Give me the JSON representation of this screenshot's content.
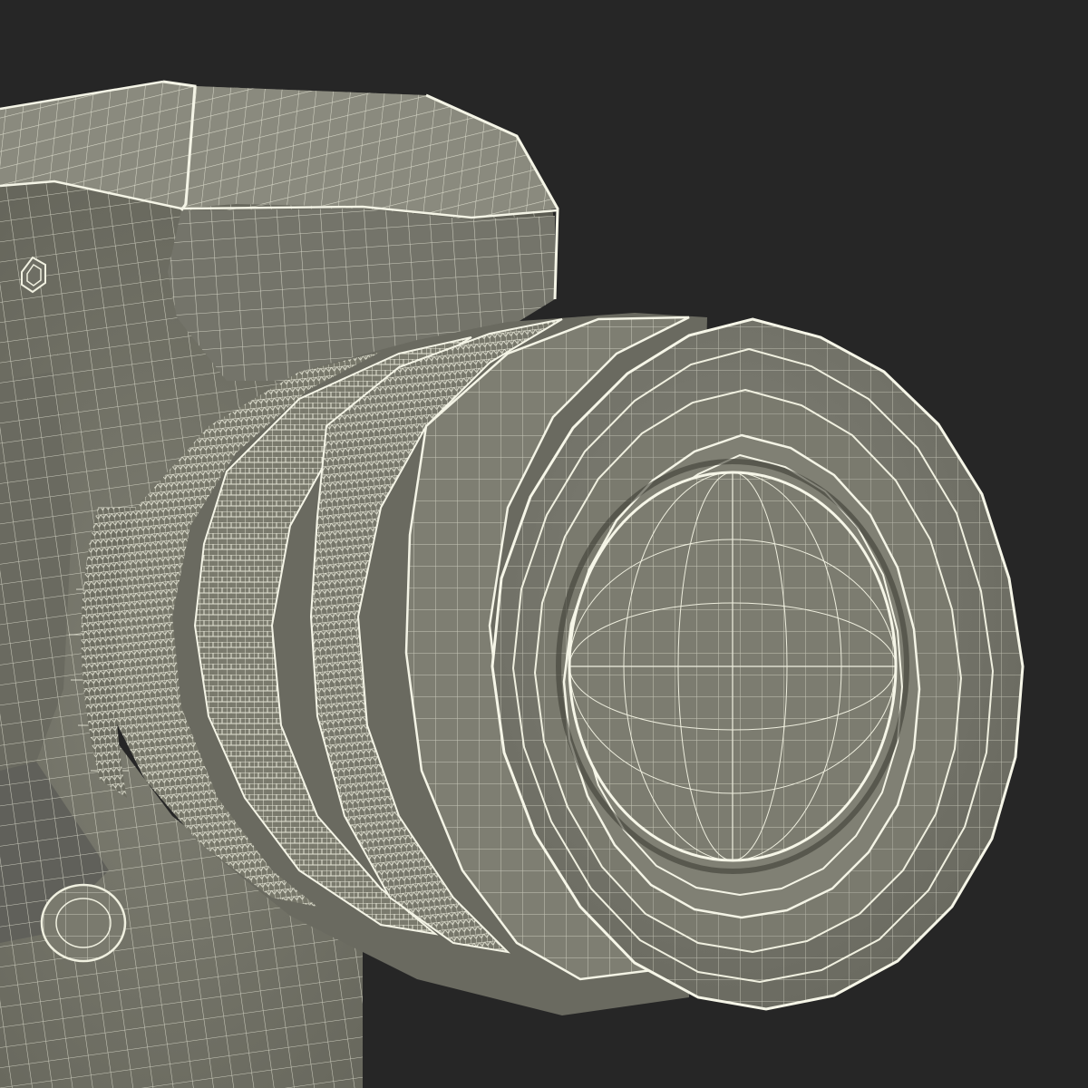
{
  "image": {
    "subject": "camera-wireframe-render",
    "colors": {
      "background": "#262626",
      "surface": "#7c7c70",
      "surface_light": "#8a8a7e",
      "surface_dark": "#5e5e54",
      "wire": "#f2f2e4",
      "wire_shadow": "#3c3c34"
    }
  }
}
